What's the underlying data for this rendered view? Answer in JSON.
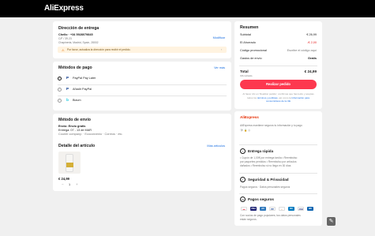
{
  "brand": "AliExpress",
  "address": {
    "title": "Dirección de entrega",
    "name": "Chello · +34 5928079845",
    "line1": "C/F / 39.23",
    "line2": "Chapineria, Madrid, Spain, 28002",
    "change_label": "Modificar",
    "notice": "Por favor, actualiza la dirección para recibir el pedido."
  },
  "payment": {
    "title": "Métodos de pago",
    "view_all": "Ver más",
    "methods": [
      {
        "icon": "paypal-icon",
        "label": "PayPal Pay Later",
        "selected": true
      },
      {
        "icon": "paypal-icon",
        "label": "Añadir PayPal",
        "selected": false
      },
      {
        "icon": "bizum-icon",
        "label": "Bizum",
        "selected": false
      }
    ]
  },
  "shipping": {
    "title": "Método de envío",
    "method": "Envío: Envío gratis",
    "delivery": "Entrega: 07 - 13 de MAR",
    "courier": "Courier company: · Ecoconvenio · Correos · etc."
  },
  "items": {
    "title": "Detalle del artículo",
    "more": "Más artículos",
    "price": "€ 24,99",
    "minus": "−",
    "plus": "+",
    "qty": "1"
  },
  "summary": {
    "title": "Resumen",
    "subtotal_label": "Subtotal",
    "subtotal_value": "€ 26,99",
    "discount_label": "El Ahorrado",
    "discount_value": "-€ 2,00",
    "promo_label": "Código promocional",
    "promo_value": "Escribe el código aquí",
    "shipping_label": "Gastos de envío",
    "shipping_value": "Gratis",
    "total_label": "Total",
    "total_value": "€ 24,99",
    "total_note": "IVA incluido",
    "place_order": "Realizar pedido",
    "legal_1": "Al hacer clic en 'Realizar pedido', confirmas que has leído y aceptas todos los",
    "legal_link1": "términos y políticas",
    "legal_2": ", así como la",
    "legal_link2": "Información para consumidores de la UE"
  },
  "trust": {
    "brand": "AliExpress",
    "brand_note": "AliExpress mantiene seguros tu información y tu pago",
    "fast_title": "Entrega rápida",
    "fast_1": "• Cupón de 1,00€ por entrega tardía • Reembolso",
    "fast_2": "por paquetes perdidos • Reembolso por artículos",
    "fast_3": "dañados • Reembolso si no llega en 30 días",
    "security_title": "Seguridad & Privacidad",
    "security_note": "Pagos seguros · Datos personales seguros",
    "pay_title": "Pagos seguros",
    "pay_note_1": "Con socios de pago populares, tus datos personales",
    "pay_note_2": "están seguros."
  },
  "colors": {
    "accent": "#fd384f",
    "link": "#1a6fe1",
    "topbar": "#000000"
  }
}
